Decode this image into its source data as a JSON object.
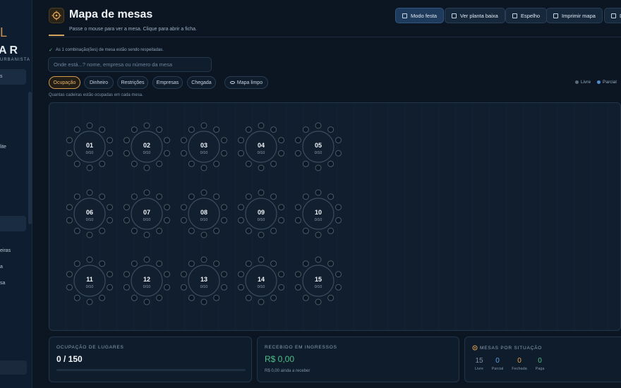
{
  "sidebar": {
    "logo_top": "L",
    "logo_main": "AR",
    "logo_sub": "URBANISTA",
    "items": [
      {
        "label": "s",
        "active": true
      },
      {
        "label": "lite",
        "active": false
      },
      {
        "label": "",
        "active": true
      },
      {
        "label": "eiras",
        "active": false
      },
      {
        "label": "a",
        "active": false
      },
      {
        "label": "sa",
        "active": false
      }
    ]
  },
  "header": {
    "title": "Mapa de mesas",
    "subtitle": "Passe o mouse para ver a mesa. Clique para abrir a ficha.",
    "buttons": [
      {
        "label": "Modo festa",
        "icon": "bookmark-icon",
        "primary": true
      },
      {
        "label": "Ver planta baixa",
        "icon": "map-icon",
        "primary": false
      },
      {
        "label": "Espelho",
        "icon": "printer-icon",
        "primary": false
      },
      {
        "label": "Imprimir mapa",
        "icon": "printer-icon",
        "primary": false
      },
      {
        "label": "D",
        "icon": "tag-icon",
        "primary": false
      }
    ]
  },
  "combo_note": "As 1 combinação(ões) de mesa estão sendo respeitadas.",
  "search": {
    "placeholder": "Onde está...? nome, empresa ou número da mesa",
    "value": ""
  },
  "filters": [
    {
      "label": "Ocupação",
      "active": true
    },
    {
      "label": "Dinheiro",
      "active": false
    },
    {
      "label": "Restrições",
      "active": false
    },
    {
      "label": "Empresas",
      "active": false
    },
    {
      "label": "Chegada",
      "active": false
    },
    {
      "label": "Mapa limpo",
      "active": false
    }
  ],
  "legend": [
    {
      "label": "Livre",
      "color": "#5b6b7c"
    },
    {
      "label": "Parcial",
      "color": "#4f8fd1"
    }
  ],
  "hint": "Quantas cadeiras estão ocupadas em cada mesa.",
  "tables": [
    {
      "number": "01",
      "occupancy": "0/10"
    },
    {
      "number": "02",
      "occupancy": "0/10"
    },
    {
      "number": "03",
      "occupancy": "0/10"
    },
    {
      "number": "04",
      "occupancy": "0/10"
    },
    {
      "number": "05",
      "occupancy": "0/10"
    },
    {
      "number": "06",
      "occupancy": "0/10"
    },
    {
      "number": "07",
      "occupancy": "0/10"
    },
    {
      "number": "08",
      "occupancy": "0/10"
    },
    {
      "number": "09",
      "occupancy": "0/10"
    },
    {
      "number": "10",
      "occupancy": "0/10"
    },
    {
      "number": "11",
      "occupancy": "0/10"
    },
    {
      "number": "12",
      "occupancy": "0/10"
    },
    {
      "number": "13",
      "occupancy": "0/10"
    },
    {
      "number": "14",
      "occupancy": "0/10"
    },
    {
      "number": "15",
      "occupancy": "0/10"
    }
  ],
  "stats": {
    "occupancy": {
      "label": "OCUPAÇÃO DE LUGARES",
      "value": "0 / 150",
      "fraction": 0
    },
    "received": {
      "label": "RECEBIDO EM INGRESSOS",
      "value": "R$ 0,00",
      "note": "R$ 0,00 ainda a receber"
    },
    "situation": {
      "label": "MESAS POR SITUAÇÃO",
      "items": [
        {
          "value": "15",
          "label": "Livre",
          "color": "#7d8fa2"
        },
        {
          "value": "0",
          "label": "Parcial",
          "color": "#5aa0e0"
        },
        {
          "value": "0",
          "label": "Fechada",
          "color": "#e8a24f"
        },
        {
          "value": "0",
          "label": "Paga",
          "color": "#4cc08a"
        }
      ]
    }
  },
  "colors": {
    "accent": "#d39a4b",
    "success": "#4cc08a",
    "info": "#4f8fd1"
  }
}
